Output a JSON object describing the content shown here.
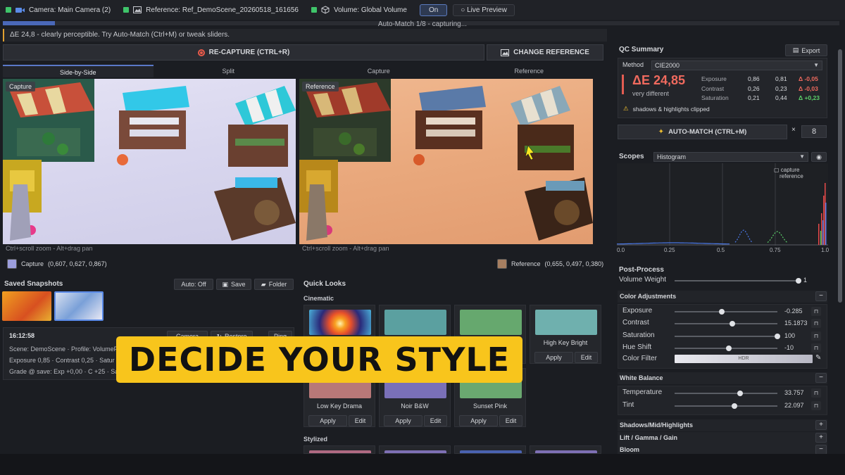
{
  "topbar": {
    "camera": "Camera: Main Camera (2)",
    "reference": "Reference: Ref_DemoScene_20260518_161656",
    "volume": "Volume: Global Volume",
    "on_label": "On",
    "live_preview": "Live Preview"
  },
  "progress": {
    "text": "Auto-Match 1/8 - capturing...",
    "fraction": 0.0625
  },
  "info_message": "ΔE 24,8 - clearly perceptible. Try Auto-Match (Ctrl+M) or tweak sliders.",
  "actions": {
    "recapture": "RE-CAPTURE (CTRL+R)",
    "change_reference": "CHANGE REFERENCE"
  },
  "view_tabs": [
    "Side-by-Side",
    "Split",
    "Capture",
    "Reference"
  ],
  "views": {
    "capture_label": "Capture",
    "reference_label": "Reference",
    "hint": "Ctrl+scroll zoom - Alt+drag pan",
    "capture_color_label": "Capture",
    "capture_color_value": "(0,607, 0,627, 0,867)",
    "capture_color": "#9c9edd",
    "reference_color_label": "Reference",
    "reference_color_value": "(0,655, 0,497, 0,380)",
    "reference_color": "#a77f61"
  },
  "snapshots": {
    "title": "Saved Snapshots",
    "auto_off": "Auto: Off",
    "save": "Save",
    "folder": "Folder",
    "time": "16:12:58",
    "btn_camera": "Camera",
    "btn_restore": "Restore",
    "btn_ping": "Ping",
    "meta_line1": "Scene: DemoScene  ·  Profile: VolumeP",
    "meta_line2": "Exposure 0,85  ·  Contrast 0,25  ·  Satur",
    "meta_line3": "Grade @ save: Exp +0,00  ·  C +25  ·  Sat"
  },
  "quick_looks": {
    "title": "Quick Looks",
    "section_cinematic": "Cinematic",
    "section_stylized": "Stylized",
    "apply": "Apply",
    "edit": "Edit",
    "cards": [
      {
        "name": "",
        "color": "#2d3a6a"
      },
      {
        "name": "",
        "color": "#5ba0a0"
      },
      {
        "name": "",
        "color": "#66a86e"
      },
      {
        "name": "High Key Bright",
        "color": "#6fb0ae"
      },
      {
        "name": "Low Key Drama",
        "color": "#b87878"
      },
      {
        "name": "Noir B&W",
        "color": "#7a70b8"
      },
      {
        "name": "Sunset Pink",
        "color": "#6aa870"
      }
    ],
    "stylized_colors": [
      "#b06a82",
      "#7e70b4",
      "#4a62b0",
      "#7e70b4"
    ]
  },
  "banner": "DECIDE YOUR STYLE",
  "qc": {
    "title": "QC Summary",
    "export": "Export",
    "method_label": "Method",
    "method_value": "CIE2000",
    "delta_e": "ΔE 24,85",
    "delta_desc": "very different",
    "rows": [
      {
        "name": "Exposure",
        "a": "0,86",
        "b": "0,81",
        "d": "Δ -0,05",
        "color": "#f06a5e"
      },
      {
        "name": "Contrast",
        "a": "0,26",
        "b": "0,23",
        "d": "Δ -0,03",
        "color": "#f06a5e"
      },
      {
        "name": "Saturation",
        "a": "0,21",
        "b": "0,44",
        "d": "Δ +0,23",
        "color": "#5ccf6a"
      }
    ],
    "warning": "shadows & highlights clipped"
  },
  "automatch": {
    "label": "AUTO-MATCH (CTRL+M)",
    "times": "×",
    "count": "8"
  },
  "scopes": {
    "title": "Scopes",
    "mode": "Histogram",
    "legend_capture": "capture",
    "legend_reference": "reference",
    "ticks": [
      "0.0",
      "0.25",
      "0.5",
      "0.75",
      "1.0"
    ]
  },
  "postprocess": {
    "title": "Post-Process",
    "volume_weight_label": "Volume Weight",
    "volume_weight_value": "1",
    "volume_weight": 1.0
  },
  "color_adjustments": {
    "title": "Color Adjustments",
    "collapse": "−",
    "sliders": [
      {
        "label": "Exposure",
        "value": "-0.285",
        "pos": 0.46
      },
      {
        "label": "Contrast",
        "value": "15.1873",
        "pos": 0.56
      },
      {
        "label": "Saturation",
        "value": "100",
        "pos": 1.0
      },
      {
        "label": "Hue Shift",
        "value": "-10",
        "pos": 0.53
      }
    ],
    "filter_label": "Color Filter",
    "filter_value": "HDR"
  },
  "white_balance": {
    "title": "White Balance",
    "collapse": "−",
    "sliders": [
      {
        "label": "Temperature",
        "value": "33.757",
        "pos": 0.64
      },
      {
        "label": "Tint",
        "value": "22.097",
        "pos": 0.58
      }
    ]
  },
  "more_sections": [
    {
      "title": "Shadows/Mid/Highlights",
      "btn": "+"
    },
    {
      "title": "Lift / Gamma / Gain",
      "btn": "+"
    },
    {
      "title": "Bloom",
      "btn": "−"
    }
  ]
}
